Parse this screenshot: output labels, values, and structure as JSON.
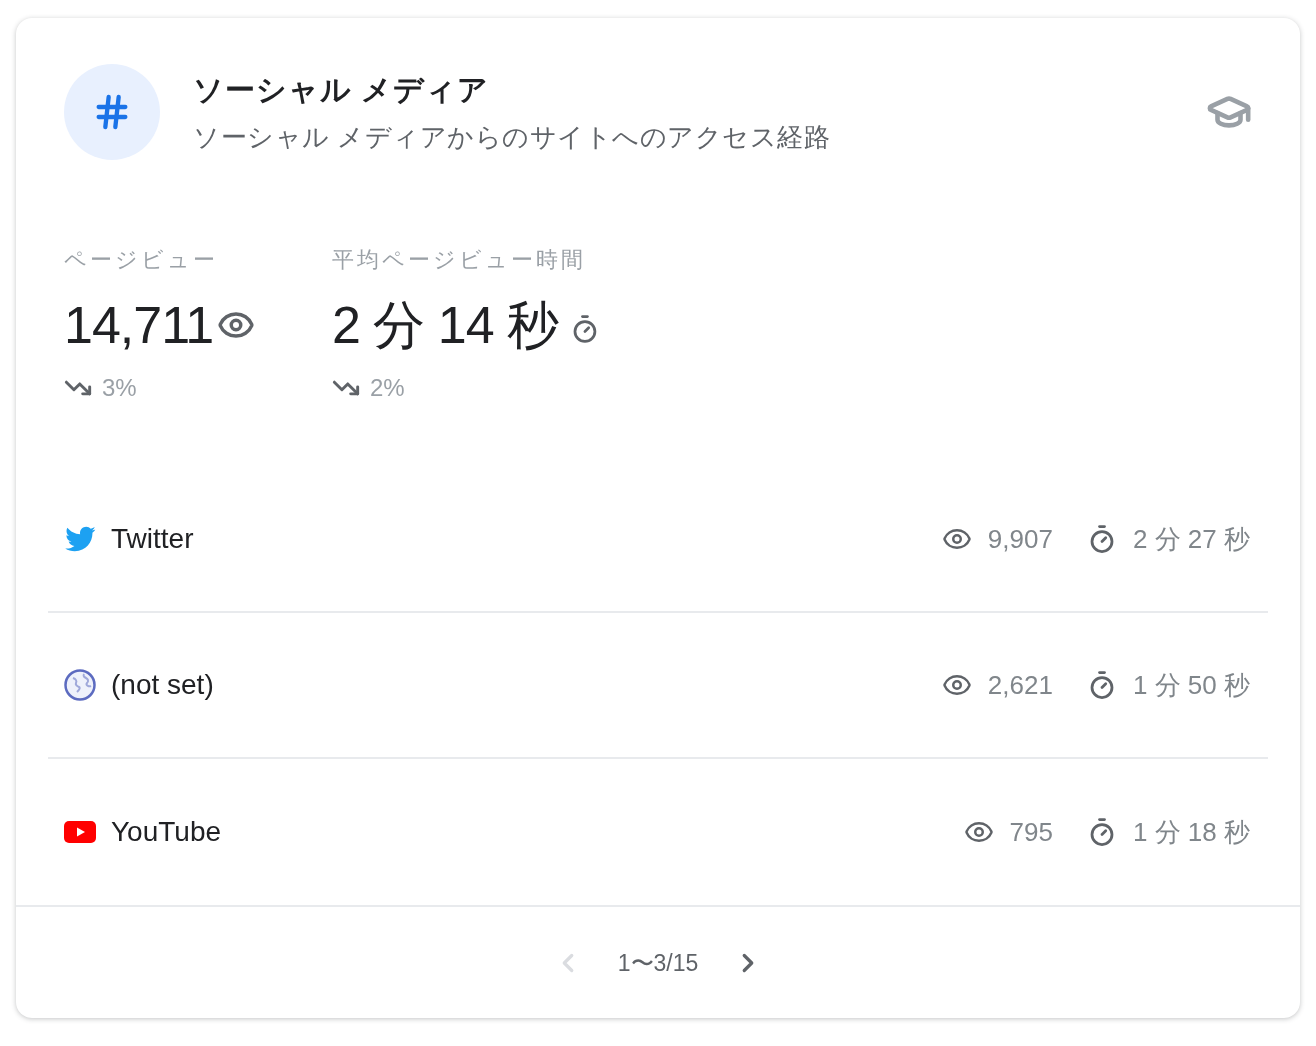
{
  "header": {
    "title": "ソーシャル メディア",
    "subtitle": "ソーシャル メディアからのサイトへのアクセス経路"
  },
  "metrics": [
    {
      "kind": "views",
      "label": "ページビュー",
      "value": "14,711",
      "change": {
        "kind": "down",
        "value": "3%"
      }
    },
    {
      "kind": "time",
      "label": "平均ページビュー時間",
      "value": "2 分 14 秒",
      "change": {
        "kind": "down",
        "value": "2%"
      }
    }
  ],
  "rows": [
    {
      "kind": "bird",
      "name": "Twitter",
      "views": "9,907",
      "time": "2 分 27 秒"
    },
    {
      "kind": "globe",
      "name": "(not set)",
      "views": "2,621",
      "time": "1 分 50 秒"
    },
    {
      "kind": "video",
      "name": "YouTube",
      "views": "795",
      "time": "1 分 18 秒"
    }
  ],
  "pagination": {
    "range": "1〜3/15",
    "previous": {
      "disabled": true
    },
    "next": {
      "disabled": false
    }
  }
}
